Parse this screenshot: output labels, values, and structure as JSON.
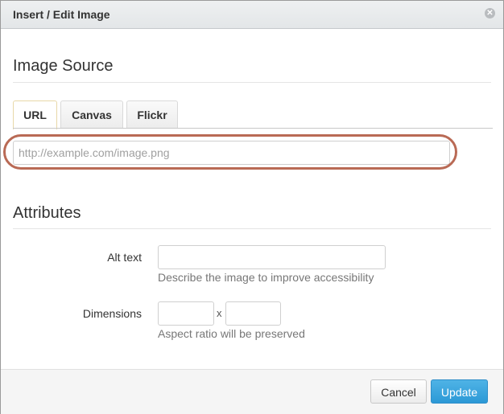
{
  "dialog": {
    "title": "Insert / Edit Image",
    "close_icon": "close-circle-icon"
  },
  "image_source": {
    "heading": "Image Source",
    "tabs": [
      {
        "label": "URL",
        "active": true
      },
      {
        "label": "Canvas",
        "active": false
      },
      {
        "label": "Flickr",
        "active": false
      }
    ],
    "url_input": {
      "value": "",
      "placeholder": "http://example.com/image.png"
    },
    "highlight_color": "#b96a55"
  },
  "attributes": {
    "heading": "Attributes",
    "alt_text": {
      "label": "Alt text",
      "value": "",
      "help": "Describe the image to improve accessibility"
    },
    "dimensions": {
      "label": "Dimensions",
      "width_value": "",
      "height_value": "",
      "separator": "x",
      "help": "Aspect ratio will be preserved"
    }
  },
  "footer": {
    "cancel_label": "Cancel",
    "update_label": "Update",
    "accent_color": "#2c99d6"
  }
}
